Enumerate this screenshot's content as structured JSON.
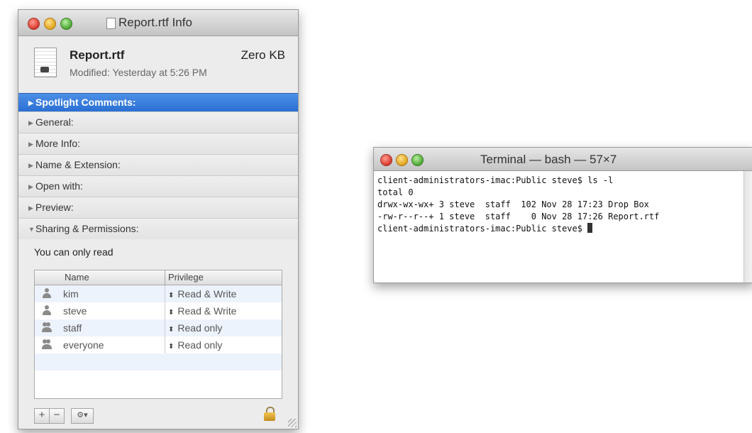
{
  "info_window": {
    "title": "Report.rtf Info",
    "file_name": "Report.rtf",
    "file_size": "Zero KB",
    "modified": "Modified: Yesterday at 5:26 PM",
    "sections": [
      {
        "label": "Spotlight Comments:",
        "active": true
      },
      {
        "label": "General:"
      },
      {
        "label": "More Info:"
      },
      {
        "label": "Name & Extension:"
      },
      {
        "label": "Open with:"
      },
      {
        "label": "Preview:"
      }
    ],
    "sharing": {
      "label": "Sharing & Permissions:",
      "note": "You can only read",
      "columns": {
        "name": "Name",
        "privilege": "Privilege"
      },
      "rows": [
        {
          "name": "kim",
          "privilege": "Read & Write",
          "icon": "user-icon"
        },
        {
          "name": "steve",
          "privilege": "Read & Write",
          "icon": "user-icon"
        },
        {
          "name": "staff",
          "privilege": "Read only",
          "icon": "group-icon"
        },
        {
          "name": "everyone",
          "privilege": "Read only",
          "icon": "everyone-icon"
        }
      ],
      "add_label": "+",
      "remove_label": "−",
      "gear_label": "⚙▾"
    }
  },
  "terminal": {
    "title": "Terminal — bash — 57×7",
    "lines": [
      "client-administrators-imac:Public steve$ ls -l",
      "total 0",
      "drwx-wx-wx+ 3 steve  staff  102 Nov 28 17:23 Drop Box",
      "-rw-r--r--+ 1 steve  staff    0 Nov 28 17:26 Report.rtf",
      "client-administrators-imac:Public steve$ "
    ]
  },
  "colors": {
    "selection_blue": "#2a6fd4",
    "close": "#d83a2e",
    "minimize": "#e0a41d",
    "zoom": "#4ca634"
  }
}
